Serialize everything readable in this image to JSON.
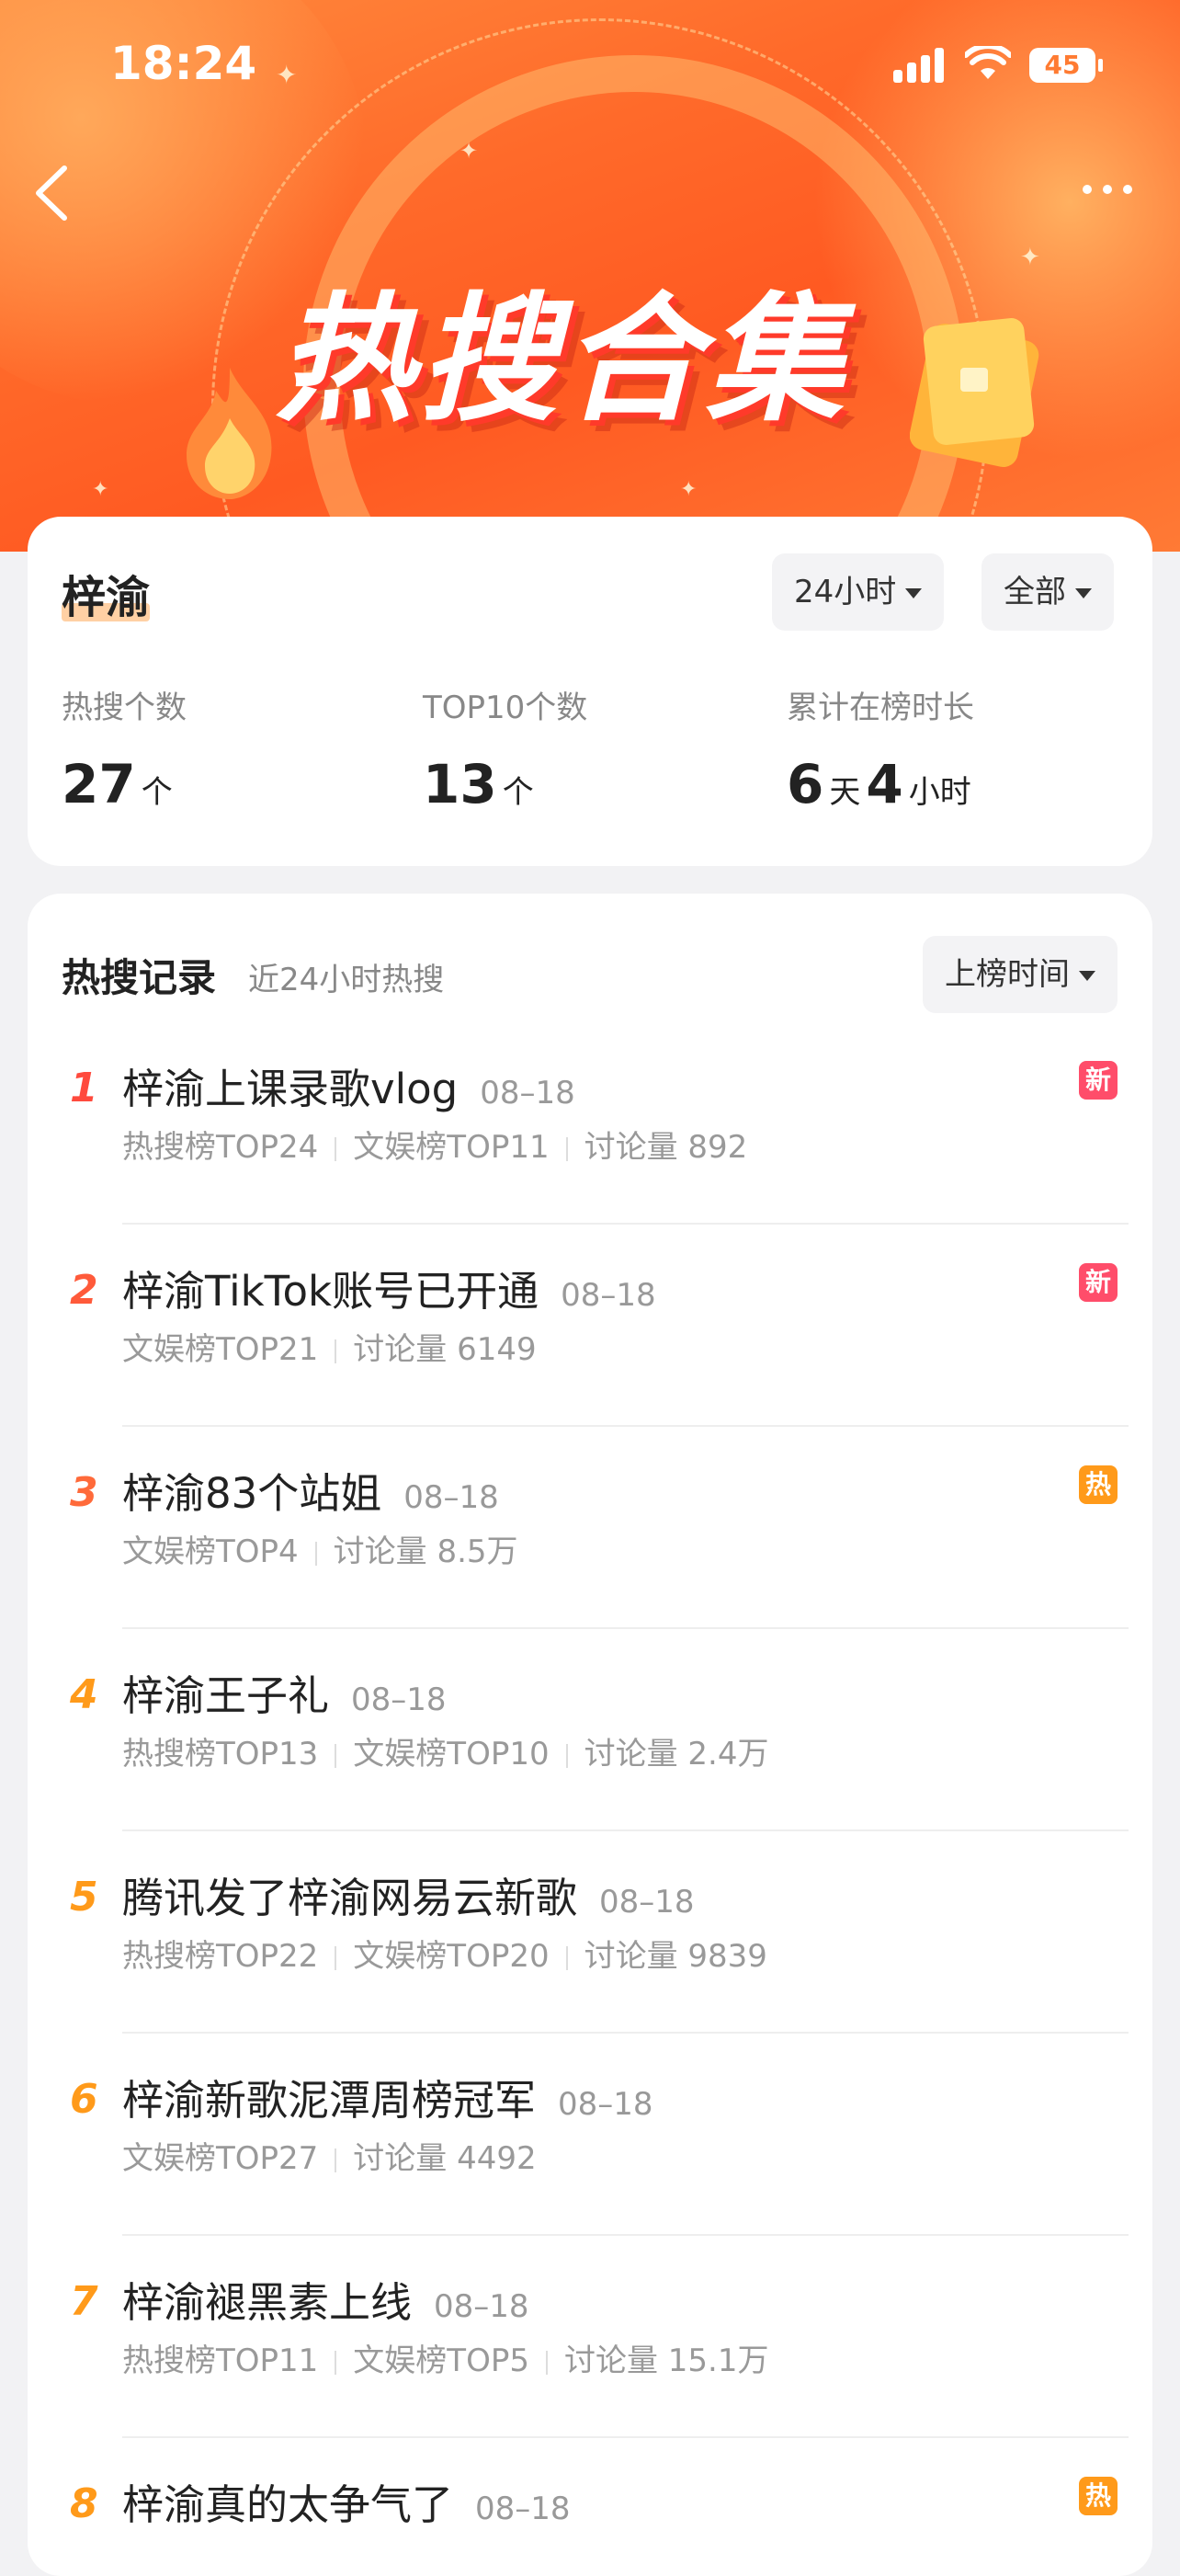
{
  "status_bar": {
    "time": "18:24",
    "battery": "45"
  },
  "header": {
    "title": "热搜合集"
  },
  "summary": {
    "name": "梓渝",
    "time_filter": "24小时",
    "category_filter": "全部",
    "stats": [
      {
        "label": "热搜个数",
        "parts": [
          {
            "num": "27",
            "unit": "个"
          }
        ]
      },
      {
        "label": "TOP10个数",
        "parts": [
          {
            "num": "13",
            "unit": "个"
          }
        ]
      },
      {
        "label": "累计在榜时长",
        "parts": [
          {
            "num": "6",
            "unit": "天"
          },
          {
            "num": "4",
            "unit": "小时"
          }
        ]
      }
    ]
  },
  "records": {
    "title": "热搜记录",
    "subtitle": "近24小时热搜",
    "sort_label": "上榜时间",
    "items": [
      {
        "rank": "1",
        "title": "梓渝上课录歌vlog",
        "date": "08–18",
        "meta": [
          "热搜榜TOP24",
          "文娱榜TOP11",
          "讨论量 892"
        ],
        "badge": "新",
        "badge_color": "#ff4d6a",
        "rank_color": "#ff4a3d"
      },
      {
        "rank": "2",
        "title": "梓渝TikTok账号已开通",
        "date": "08–18",
        "meta": [
          "文娱榜TOP21",
          "讨论量 6149"
        ],
        "badge": "新",
        "badge_color": "#ff4d6a",
        "rank_color": "#ff5a3a"
      },
      {
        "rank": "3",
        "title": "梓渝83个站姐",
        "date": "08–18",
        "meta": [
          "文娱榜TOP4",
          "讨论量 8.5万"
        ],
        "badge": "热",
        "badge_color": "#ff9a1a",
        "rank_color": "#ff6a3a"
      },
      {
        "rank": "4",
        "title": "梓渝王子礼",
        "date": "08–18",
        "meta": [
          "热搜榜TOP13",
          "文娱榜TOP10",
          "讨论量 2.4万"
        ],
        "badge": "",
        "badge_color": "",
        "rank_color": "#ff9a1a"
      },
      {
        "rank": "5",
        "title": "腾讯发了梓渝网易云新歌",
        "date": "08–18",
        "meta": [
          "热搜榜TOP22",
          "文娱榜TOP20",
          "讨论量 9839"
        ],
        "badge": "",
        "badge_color": "",
        "rank_color": "#ff9a1a"
      },
      {
        "rank": "6",
        "title": "梓渝新歌泥潭周榜冠军",
        "date": "08–18",
        "meta": [
          "文娱榜TOP27",
          "讨论量 4492"
        ],
        "badge": "",
        "badge_color": "",
        "rank_color": "#ff9a1a"
      },
      {
        "rank": "7",
        "title": "梓渝褪黑素上线",
        "date": "08–18",
        "meta": [
          "热搜榜TOP11",
          "文娱榜TOP5",
          "讨论量 15.1万"
        ],
        "badge": "",
        "badge_color": "",
        "rank_color": "#ff9a1a"
      },
      {
        "rank": "8",
        "title": "梓渝真的太争气了",
        "date": "08–18",
        "meta": [],
        "badge": "热",
        "badge_color": "#ff9a1a",
        "rank_color": "#ff9a1a"
      }
    ]
  }
}
